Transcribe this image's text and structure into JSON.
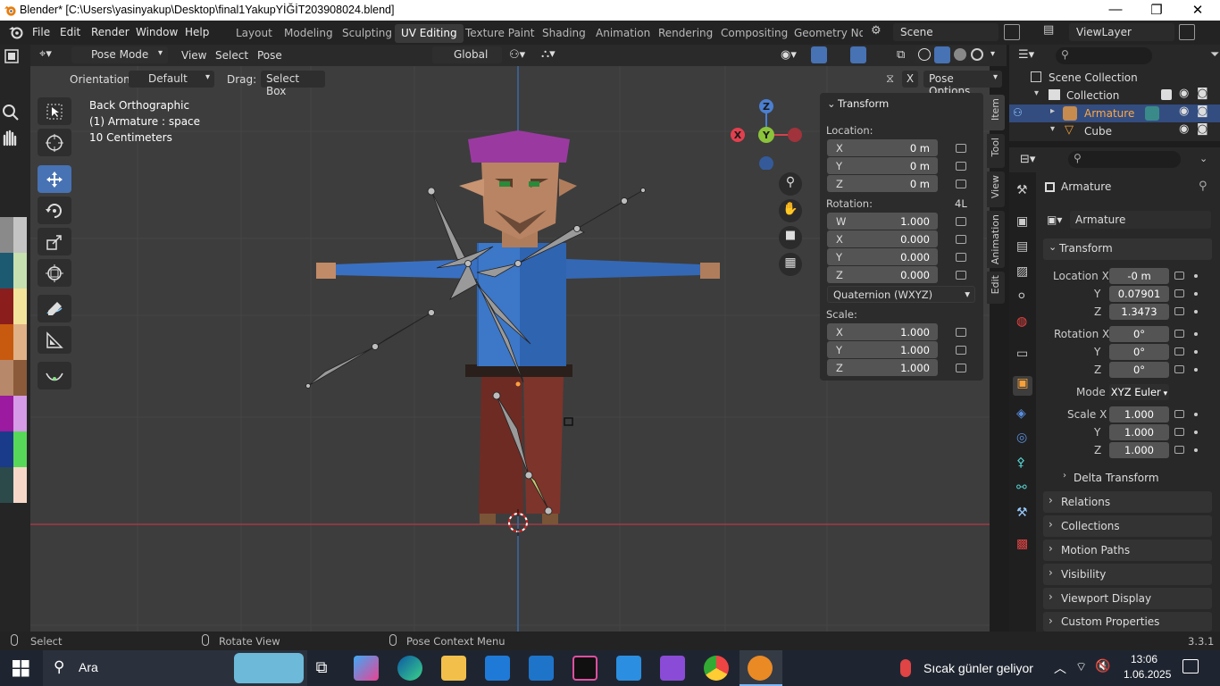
{
  "title": {
    "text": "Blender* [C:\\Users\\yasinyakup\\Desktop\\final1YakupYİĞİT203908024.blend]"
  },
  "menu": {
    "items": [
      "File",
      "Edit",
      "Render",
      "Window",
      "Help"
    ]
  },
  "workspaces": [
    "Layout",
    "Modeling",
    "Sculpting",
    "UV Editing",
    "Texture Paint",
    "Shading",
    "Animation",
    "Rendering",
    "Compositing",
    "Geometry Noc"
  ],
  "scene": {
    "label": "Scene",
    "viewlayer": "ViewLayer"
  },
  "viewport_header": {
    "mode": "Pose Mode",
    "menus": [
      "View",
      "Select",
      "Pose"
    ],
    "transform_orientation": "Global",
    "orientation_label": "Orientation:",
    "orientation_value": "Default",
    "drag_label": "Drag:",
    "drag_value": "Select Box",
    "pose_options": "Pose Options",
    "x_label": "X"
  },
  "overlay_text": {
    "line1": "Back Orthographic",
    "line2": "(1) Armature : space",
    "line3": "10 Centimeters"
  },
  "gizmo": {
    "x": "X",
    "y": "Y",
    "z": "Z"
  },
  "npanel": {
    "title": "Transform",
    "location_label": "Location:",
    "location": [
      {
        "axis": "X",
        "value": "0 m"
      },
      {
        "axis": "Y",
        "value": "0 m"
      },
      {
        "axis": "Z",
        "value": "0 m"
      }
    ],
    "rotation_label": "Rotation:",
    "rotation_mode_short": "4L",
    "rotation": [
      {
        "axis": "W",
        "value": "1.000"
      },
      {
        "axis": "X",
        "value": "0.000"
      },
      {
        "axis": "Y",
        "value": "0.000"
      },
      {
        "axis": "Z",
        "value": "0.000"
      }
    ],
    "rotation_mode": "Quaternion (WXYZ)",
    "scale_label": "Scale:",
    "scale": [
      {
        "axis": "X",
        "value": "1.000"
      },
      {
        "axis": "Y",
        "value": "1.000"
      },
      {
        "axis": "Z",
        "value": "1.000"
      }
    ]
  },
  "sidebar_tabs": [
    "Item",
    "Tool",
    "View",
    "Animation",
    "Edit"
  ],
  "outliner": {
    "rows": [
      {
        "label": "Scene Collection"
      },
      {
        "label": "Collection"
      },
      {
        "label": "Armature"
      },
      {
        "label": "Cube"
      }
    ]
  },
  "properties": {
    "object_name": "Armature",
    "data_name": "Armature",
    "transform_title": "Transform",
    "location_x_label": "Location X",
    "location": [
      "-0 m",
      "0.07901",
      "1.3473"
    ],
    "rotation_x_label": "Rotation X",
    "rotation": [
      "0°",
      "0°",
      "0°"
    ],
    "mode_label": "Mode",
    "mode_value": "XYZ Euler",
    "scale_x_label": "Scale X",
    "scale": [
      "1.000",
      "1.000",
      "1.000"
    ],
    "y_label": "Y",
    "z_label": "Z",
    "delta_transform": "Delta Transform",
    "sections": [
      "Relations",
      "Collections",
      "Motion Paths",
      "Visibility",
      "Viewport Display",
      "Custom Properties"
    ]
  },
  "statusbar": {
    "select": "Select",
    "rotate": "Rotate View",
    "context": "Pose Context Menu",
    "version": "3.3.1"
  },
  "taskbar": {
    "search": "Ara",
    "weather": "Sıcak günler geliyor",
    "time": "13:06",
    "date": "1.06.2025"
  },
  "colors": {
    "accent": "#4772b3",
    "viewport_bg": "#3d3d3d",
    "palette": [
      "#8a8a8a",
      "#c4c4c4",
      "#1c5a72",
      "#c6e0b0",
      "#8b1d1d",
      "#f3e49b",
      "#c85a0f",
      "#e0b186",
      "#b7886a",
      "#8a5a3a",
      "#9b1aa0",
      "#d59be6",
      "#1a3a8a",
      "#58d858",
      "#2c4a4a",
      "#f7d8c8"
    ]
  }
}
